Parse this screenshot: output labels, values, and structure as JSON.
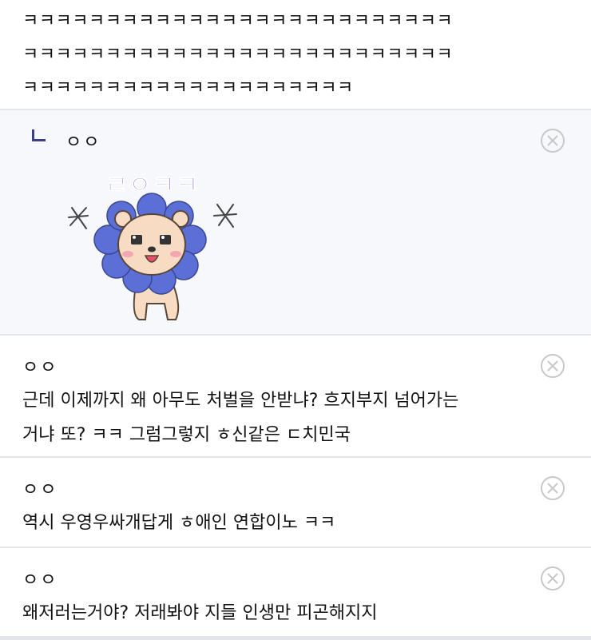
{
  "post": {
    "text_lines": [
      "ㅋㅋㅋㅋㅋㅋㅋㅋㅋㅋㅋㅋㅋㅋㅋㅋㅋㅋㅋㅋㅋㅋㅋㅋㅋㅋ",
      "ㅋㅋㅋㅋㅋㅋㅋㅋㅋㅋㅋㅋㅋㅋㅋㅋㅋㅋㅋㅋㅋㅋㅋㅋㅋㅋ",
      "ㅋㅋㅋㅋㅋㅋㅋㅋㅋㅋㅋㅋㅋㅋㅋㅋㅋㅋㅋㅋ"
    ]
  },
  "comments": [
    {
      "type": "reply",
      "author": "ㅇㅇ",
      "sticker_text": "ㄹㅇㅋㅋ",
      "sticker_icon": "lion-flower-sticker"
    },
    {
      "type": "comment",
      "author": "ㅇㅇ",
      "lines": [
        "근데 이제까지 왜 아무도 처벌을 안받냐? 흐지부지 넘어가는",
        "거냐 또? ㅋㅋ 그럼그렇지 ㅎ신같은 ㄷ치민국"
      ]
    },
    {
      "type": "comment",
      "author": "ㅇㅇ",
      "lines": [
        "역시 우영우싸개답게 ㅎ애인 연합이노 ㅋㅋ"
      ]
    },
    {
      "type": "comment",
      "author": "ㅇㅇ",
      "lines": [
        "왜저러는거야? 저래봐야 지들 인생만 피곤해지지"
      ]
    }
  ],
  "icons": {
    "delete": "close-circle-icon",
    "reply": "reply-arrow-icon"
  },
  "colors": {
    "divider": "#e3e5ea",
    "reply_bg": "#f7f8fc",
    "reply_mark": "#3b3f8c",
    "icon_gray": "#c8c8c8",
    "sticker_blue": "#5b6fd6",
    "sticker_text": "#7b55d8"
  }
}
